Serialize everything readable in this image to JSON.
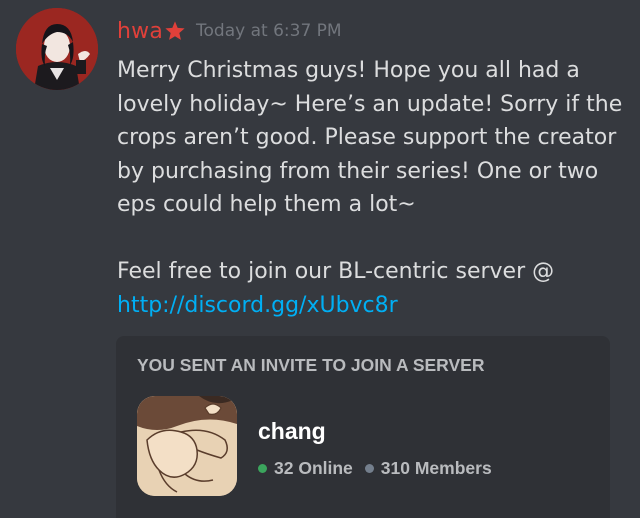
{
  "message": {
    "author": {
      "username": "hwa",
      "username_color": "#e0403a",
      "badge_icon": "star-icon",
      "avatar_icon": "avatar"
    },
    "timestamp": "Today at 6:37 PM",
    "lines": [
      "Merry Christmas guys! Hope you all had a",
      "lovely holiday~ Here’s an update! Sorry if the",
      "crops aren’t good. Please support the creator",
      "by purchasing from their series! One or two",
      "eps could help them a lot~"
    ],
    "line2": "Feel free to join our BL-centric server @",
    "link": "http://discord.gg/xUbvc8r",
    "link_color": "#00aff4"
  },
  "invite": {
    "title": "YOU SENT AN INVITE TO JOIN A SERVER",
    "server_name": "chang",
    "online_count": "32 Online",
    "member_count": "310 Members",
    "online_color": "#3ba55d",
    "members_color": "#747f8d"
  }
}
